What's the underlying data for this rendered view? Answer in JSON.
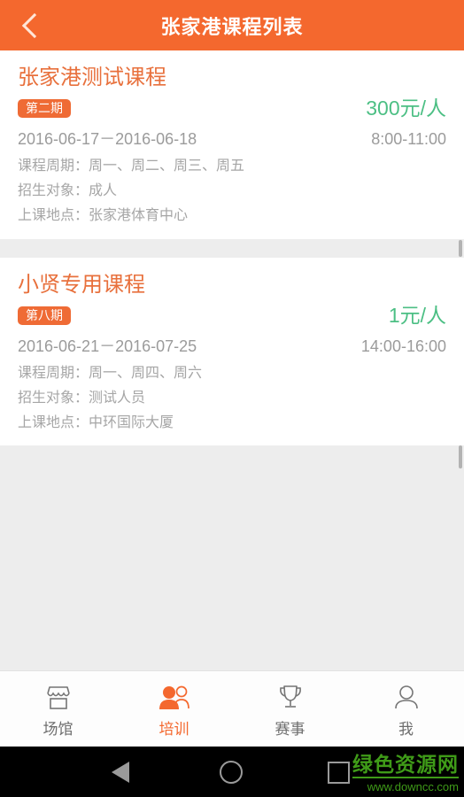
{
  "header": {
    "title": "张家港课程列表",
    "back_icon": "chevron-left-icon",
    "bg_color": "#f4682e"
  },
  "courses": [
    {
      "title": "张家港测试课程",
      "term_badge": "第二期",
      "price": "300元/人",
      "date_range": "2016-06-17－2016-06-18",
      "time_range": "8:00-11:00",
      "period": "课程周期：周一、周二、周三、周五",
      "audience": "招生对象：成人",
      "location": "上课地点：张家港体育中心"
    },
    {
      "title": "小贤专用课程",
      "term_badge": "第八期",
      "price": "1元/人",
      "date_range": "2016-06-21－2016-07-25",
      "time_range": "14:00-16:00",
      "period": "课程周期：周一、周四、周六",
      "audience": "招生对象：测试人员",
      "location": "上课地点：中环国际大厦"
    }
  ],
  "tabbar": {
    "items": [
      {
        "label": "场馆",
        "icon": "storefront-icon",
        "active": false
      },
      {
        "label": "培训",
        "icon": "people-icon",
        "active": true
      },
      {
        "label": "赛事",
        "icon": "trophy-icon",
        "active": false
      },
      {
        "label": "我",
        "icon": "person-icon",
        "active": false
      }
    ],
    "active_color": "#f4682e",
    "inactive_color": "#6d6d6d"
  },
  "navbar": {
    "back_icon": "triangle-back-icon",
    "home_icon": "circle-home-icon",
    "recents_icon": "square-recents-icon"
  },
  "watermark": {
    "name": "绿色资源网",
    "url": "www.downcc.com",
    "color": "#3f9b18"
  }
}
